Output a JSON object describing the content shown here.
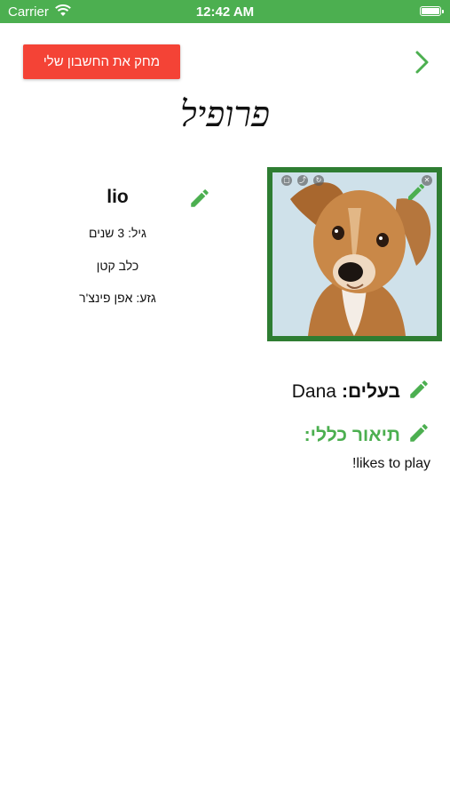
{
  "status_bar": {
    "carrier": "Carrier",
    "time": "12:42 AM"
  },
  "header": {
    "delete_account_label": "מחק את החשבון שלי",
    "title": "פרופיל"
  },
  "pet": {
    "name": "lio",
    "age": "גיל: 3 שנים",
    "size": "כלב קטן",
    "breed": "גזע: אפן פינצ'ר"
  },
  "owner": {
    "label": "בעלים:",
    "value": "Dana"
  },
  "description": {
    "label": "תיאור כללי:",
    "text": "likes to play!"
  },
  "colors": {
    "accent_green": "#4caf50",
    "frame_green": "#2e7d32",
    "danger_red": "#f44336"
  }
}
